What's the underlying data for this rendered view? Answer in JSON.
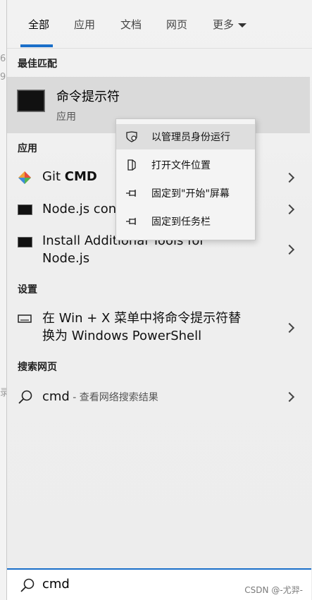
{
  "background": {
    "fragments": [
      "6",
      "9",
      "录"
    ]
  },
  "tabs": [
    {
      "label": "全部",
      "active": true
    },
    {
      "label": "应用"
    },
    {
      "label": "文档"
    },
    {
      "label": "网页"
    },
    {
      "label": "更多"
    }
  ],
  "best_match": {
    "heading": "最佳匹配",
    "title": "命令提示符",
    "subtitle": "应用",
    "icon": "cmd-icon"
  },
  "apps": {
    "heading": "应用",
    "items": [
      {
        "label_prefix": "Git ",
        "label_bold": "CMD",
        "icon": "git-icon"
      },
      {
        "label": "Node.js con",
        "icon": "cmd-icon"
      },
      {
        "label_line1": "Install Additional Tools for",
        "label_line2": "Node.js",
        "icon": "cmd-icon"
      }
    ]
  },
  "settings": {
    "heading": "设置",
    "item_line1": "在 Win + X 菜单中将命令提示符替",
    "item_line2": "换为 Windows PowerShell",
    "icon": "keyboard-icon"
  },
  "web": {
    "heading": "搜索网页",
    "query": "cmd",
    "suffix": " - 查看网络搜索结果",
    "icon": "search-icon"
  },
  "context_menu": [
    {
      "label": "以管理员身份运行",
      "icon": "shield-icon"
    },
    {
      "label": "打开文件位置",
      "icon": "folder-icon"
    },
    {
      "label": "固定到\"开始\"屏幕",
      "icon": "pin-icon"
    },
    {
      "label": "固定到任务栏",
      "icon": "pin-icon"
    }
  ],
  "search_bar": {
    "query": "cmd"
  },
  "watermark": "CSDN @-尤羿-",
  "colors": {
    "accent": "#1a6fc9",
    "panel": "#eeeeee",
    "highlight": "#dadada"
  }
}
